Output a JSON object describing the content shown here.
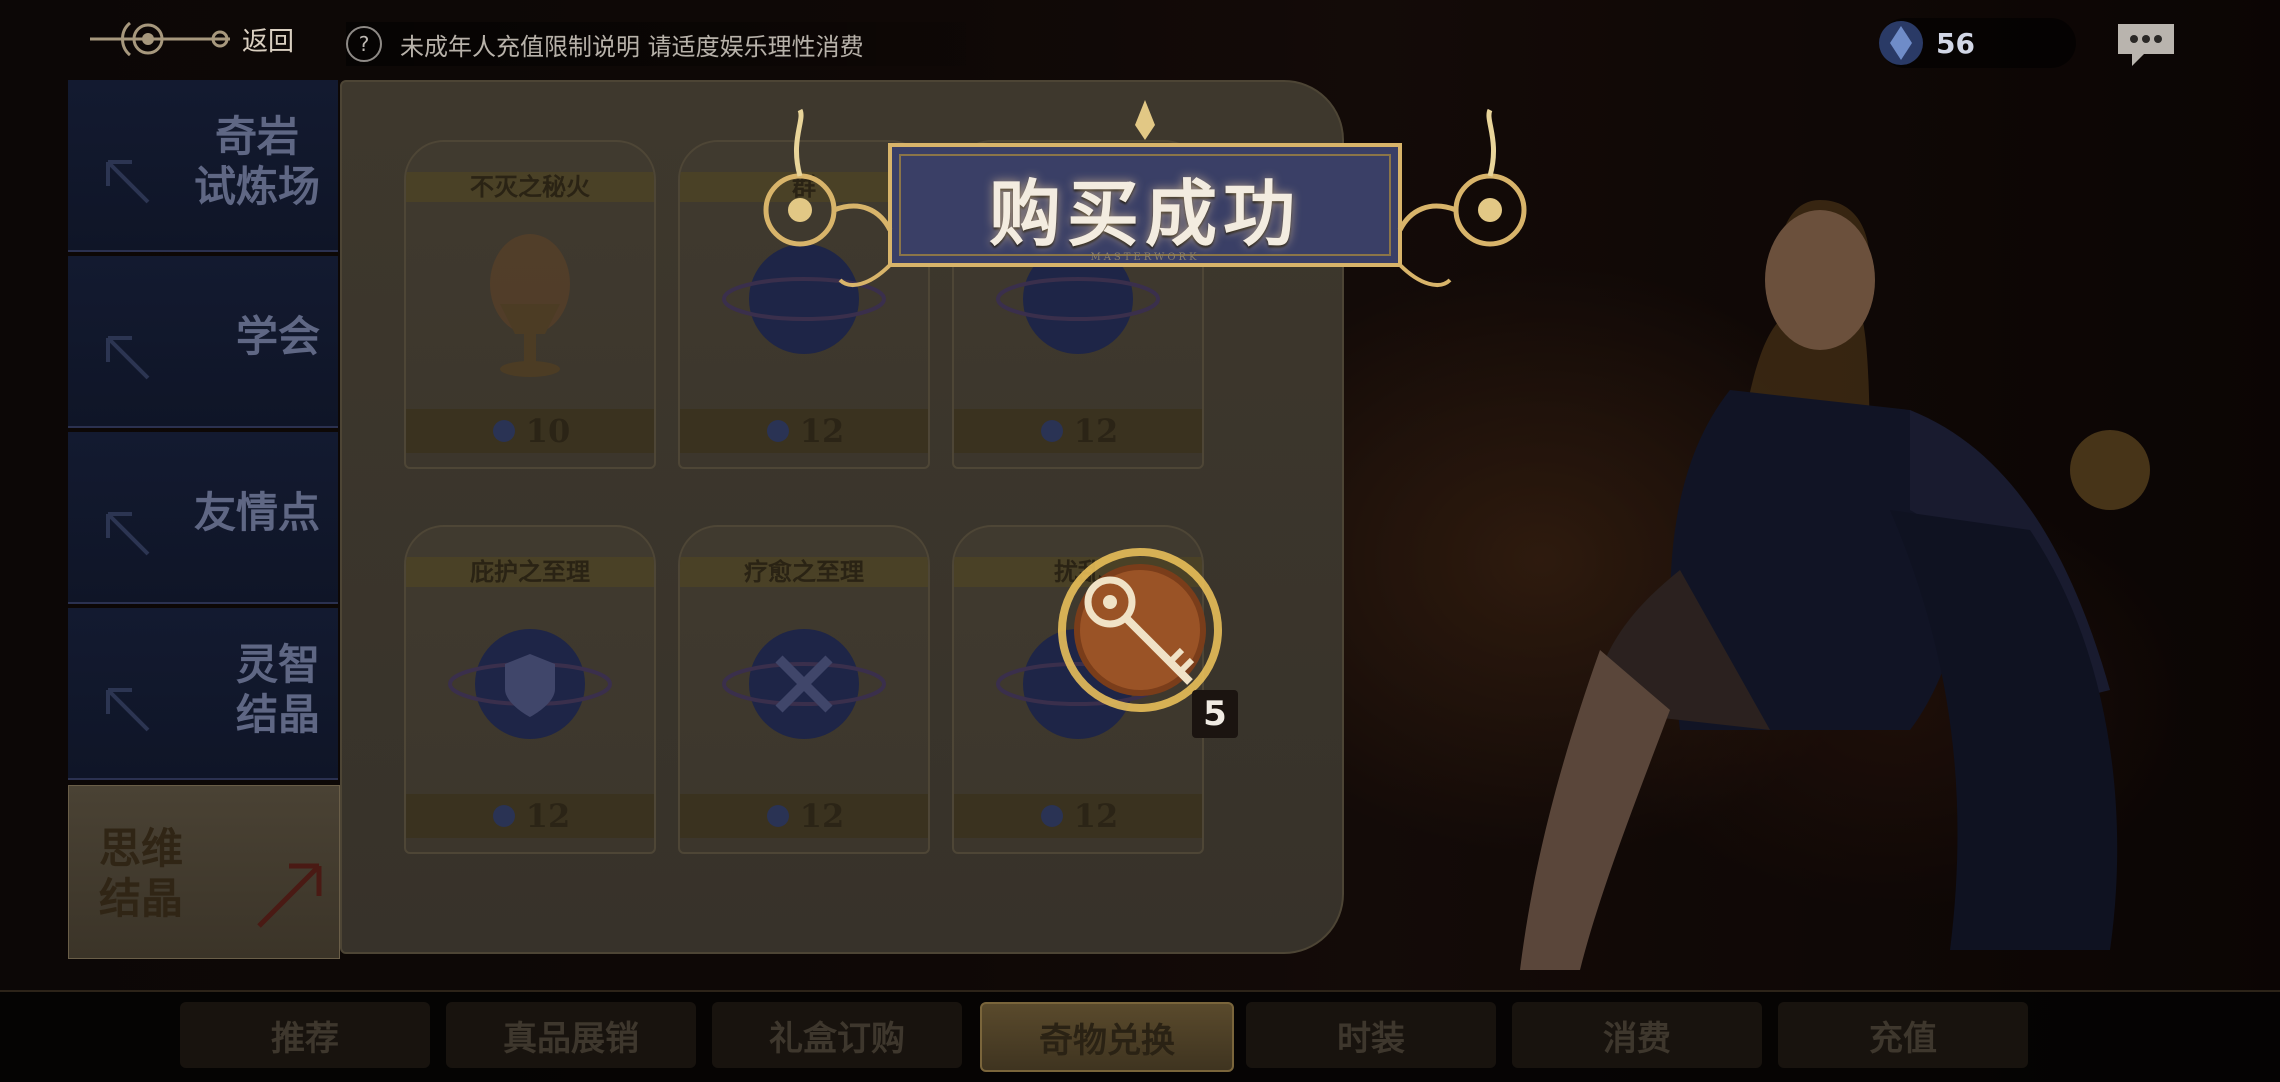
{
  "topbar": {
    "back_label": "返回",
    "notice_icon": "?",
    "notice_text": "未成年人充值限制说明  请适度娱乐理性消费",
    "currency_value": "56"
  },
  "categories": [
    {
      "label_line1": "奇岩",
      "label_line2": "试炼场"
    },
    {
      "label_line1": "学会",
      "label_line2": ""
    },
    {
      "label_line1": "友情点",
      "label_line2": ""
    },
    {
      "label_line1": "灵智",
      "label_line2": "结晶"
    }
  ],
  "active_category": {
    "label_line1": "思维",
    "label_line2": "结晶"
  },
  "products": [
    {
      "name": "不灭之秘火",
      "price": "10"
    },
    {
      "name": "群",
      "price": "12"
    },
    {
      "name": "",
      "price": "12"
    },
    {
      "name": "庇护之至理",
      "price": "12"
    },
    {
      "name": "疗愈之至理",
      "price": "12"
    },
    {
      "name": "扰乱",
      "price": "12"
    }
  ],
  "banner": {
    "title": "购买成功",
    "subtitle": "MASTERWORK"
  },
  "reward": {
    "count": "5",
    "icon": "key-icon"
  },
  "tabs": [
    "推荐",
    "真品展销",
    "礼盒订购",
    "奇物兑换",
    "时装",
    "消费",
    "充值"
  ],
  "active_tab": "奇物兑换",
  "colors": {
    "accent_gold": "#d8b46a",
    "panel_blue": "#131a30",
    "banner_navy": "#3a3f66"
  }
}
